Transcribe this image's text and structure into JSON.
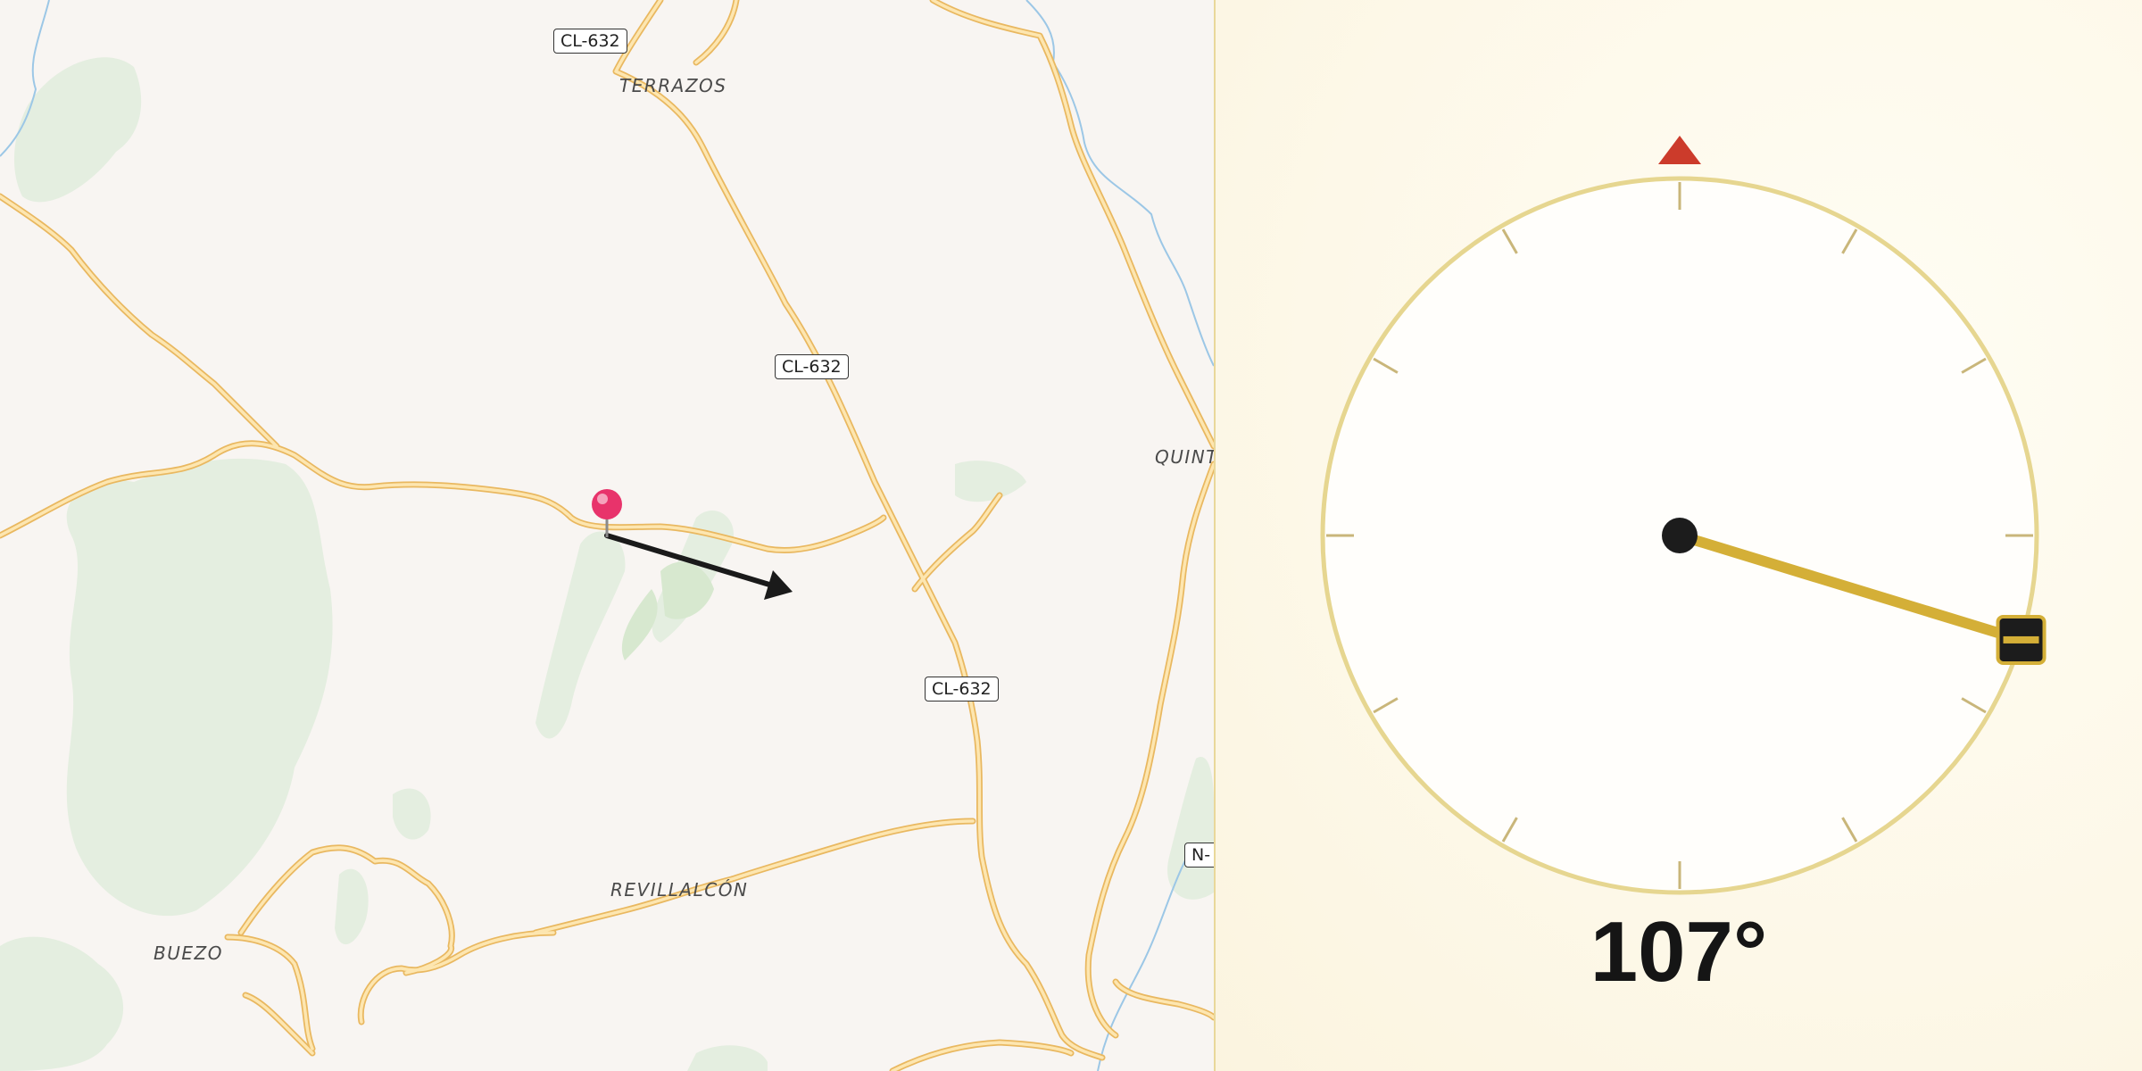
{
  "map": {
    "places": [
      {
        "name": "TERRAZOS"
      },
      {
        "name": "QUINT"
      },
      {
        "name": "REVILLALCÓN"
      },
      {
        "name": "BUEZO"
      }
    ],
    "road_shields": [
      {
        "label": "CL-632"
      },
      {
        "label": "CL-632"
      },
      {
        "label": "CL-632"
      },
      {
        "label": "N-"
      }
    ],
    "marker": {
      "color": "#e8336b",
      "icon": "map-pin-icon"
    },
    "direction_arrow": {
      "icon": "arrow-icon",
      "color": "#1a1a1a"
    }
  },
  "compass": {
    "bearing_degrees": 107,
    "bearing_text": "107°",
    "ring_color": "#e6d690",
    "needle_color": "#d4af37",
    "north_marker_color": "#cc3b2b",
    "north_marker_icon": "triangle-icon",
    "needle_handle_icon": "needle-handle-icon"
  }
}
